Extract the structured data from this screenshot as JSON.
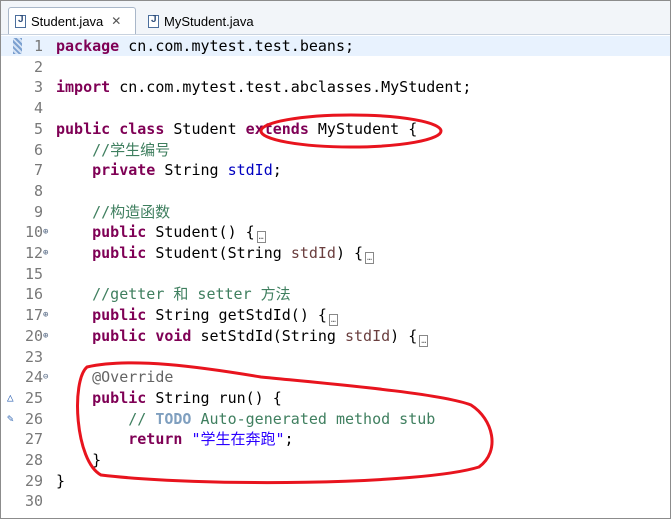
{
  "tabs": [
    {
      "label": "Student.java",
      "close": "✕"
    },
    {
      "label": "MyStudent.java"
    }
  ],
  "lines": [
    {
      "num": "1",
      "parts": [
        [
          "kw",
          "package"
        ],
        [
          "",
          " cn.com.mytest.test.beans;"
        ]
      ]
    },
    {
      "num": "2",
      "parts": []
    },
    {
      "num": "3",
      "parts": [
        [
          "kw",
          "import"
        ],
        [
          "",
          " cn.com.mytest.test.abclasses.MyStudent;"
        ]
      ]
    },
    {
      "num": "4",
      "parts": []
    },
    {
      "num": "5",
      "parts": [
        [
          "kw",
          "public"
        ],
        [
          "",
          " "
        ],
        [
          "kw",
          "class"
        ],
        [
          "",
          " Student "
        ],
        [
          "kw",
          "extends"
        ],
        [
          "",
          " MyStudent {"
        ]
      ]
    },
    {
      "num": "6",
      "parts": [
        [
          "",
          "    "
        ],
        [
          "comment",
          "//学生编号"
        ]
      ]
    },
    {
      "num": "7",
      "parts": [
        [
          "",
          "    "
        ],
        [
          "kw",
          "private"
        ],
        [
          "",
          " String "
        ],
        [
          "field",
          "stdId"
        ],
        [
          "",
          ";"
        ]
      ]
    },
    {
      "num": "8",
      "parts": []
    },
    {
      "num": "9",
      "parts": [
        [
          "",
          "    "
        ],
        [
          "comment",
          "//构造函数"
        ]
      ]
    },
    {
      "num": "10",
      "fold": "⊕",
      "parts": [
        [
          "",
          "    "
        ],
        [
          "kw",
          "public"
        ],
        [
          "",
          " Student() {"
        ]
      ],
      "box": true
    },
    {
      "num": "12",
      "fold": "⊕",
      "parts": [
        [
          "",
          "    "
        ],
        [
          "kw",
          "public"
        ],
        [
          "",
          " Student(String "
        ],
        [
          "param",
          "stdId"
        ],
        [
          "",
          ") {"
        ]
      ],
      "box": true
    },
    {
      "num": "15",
      "parts": []
    },
    {
      "num": "16",
      "parts": [
        [
          "",
          "    "
        ],
        [
          "comment",
          "//getter 和 setter 方法"
        ]
      ]
    },
    {
      "num": "17",
      "fold": "⊕",
      "parts": [
        [
          "",
          "    "
        ],
        [
          "kw",
          "public"
        ],
        [
          "",
          " String getStdId() {"
        ]
      ],
      "box": true
    },
    {
      "num": "20",
      "fold": "⊕",
      "parts": [
        [
          "",
          "    "
        ],
        [
          "kw",
          "public"
        ],
        [
          "",
          " "
        ],
        [
          "kw",
          "void"
        ],
        [
          "",
          " setStdId(String "
        ],
        [
          "param",
          "stdId"
        ],
        [
          "",
          ") {"
        ]
      ],
      "box": true
    },
    {
      "num": "23",
      "parts": []
    },
    {
      "num": "24",
      "fold": "⊖",
      "parts": [
        [
          "",
          "    "
        ],
        [
          "ann",
          "@Override"
        ]
      ]
    },
    {
      "num": "25",
      "mark": "override",
      "parts": [
        [
          "",
          "    "
        ],
        [
          "kw",
          "public"
        ],
        [
          "",
          " String run() {"
        ]
      ]
    },
    {
      "num": "26",
      "mark": "task",
      "parts": [
        [
          "",
          "        "
        ],
        [
          "comment",
          "// "
        ],
        [
          "todo",
          "TODO"
        ],
        [
          "comment",
          " Auto-generated method stub"
        ]
      ]
    },
    {
      "num": "27",
      "parts": [
        [
          "",
          "        "
        ],
        [
          "kw",
          "return"
        ],
        [
          "",
          " "
        ],
        [
          "str",
          "\"学生在奔跑\""
        ],
        [
          "",
          ";"
        ]
      ]
    },
    {
      "num": "28",
      "parts": [
        [
          "",
          "    }"
        ]
      ]
    },
    {
      "num": "29",
      "parts": [
        [
          "",
          "}"
        ]
      ]
    },
    {
      "num": "30",
      "parts": []
    }
  ],
  "colors": {
    "annotation_circle": "#e8141e",
    "keyword": "#7f0055",
    "comment": "#3f7f5f",
    "string": "#2a00ff",
    "field": "#0000c0"
  }
}
